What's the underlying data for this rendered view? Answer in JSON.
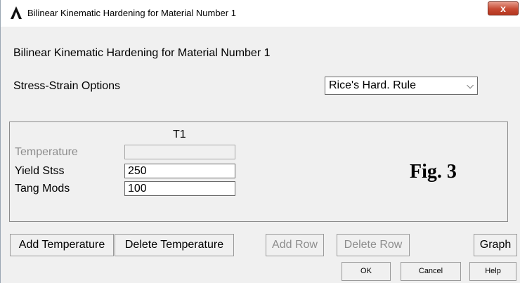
{
  "window": {
    "title": "Bilinear Kinematic Hardening for Material Number 1",
    "close_glyph": "x"
  },
  "dialog": {
    "heading": "Bilinear Kinematic Hardening for Material Number 1",
    "stress_strain": {
      "label": "Stress-Strain Options",
      "selected": "Rice's Hard. Rule",
      "arrow": "⌵"
    }
  },
  "table": {
    "column_header": "T1",
    "rows": [
      {
        "label": "Temperature",
        "value": ""
      },
      {
        "label": "Yield Stss",
        "value": "250"
      },
      {
        "label": "Tang Mods",
        "value": "100"
      }
    ]
  },
  "figure_label": "Fig. 3",
  "buttons": {
    "add_temperature": "Add Temperature",
    "delete_temperature": "Delete Temperature",
    "add_row": "Add Row",
    "delete_row": "Delete Row",
    "graph": "Graph",
    "ok": "OK",
    "cancel": "Cancel",
    "help": "Help"
  }
}
